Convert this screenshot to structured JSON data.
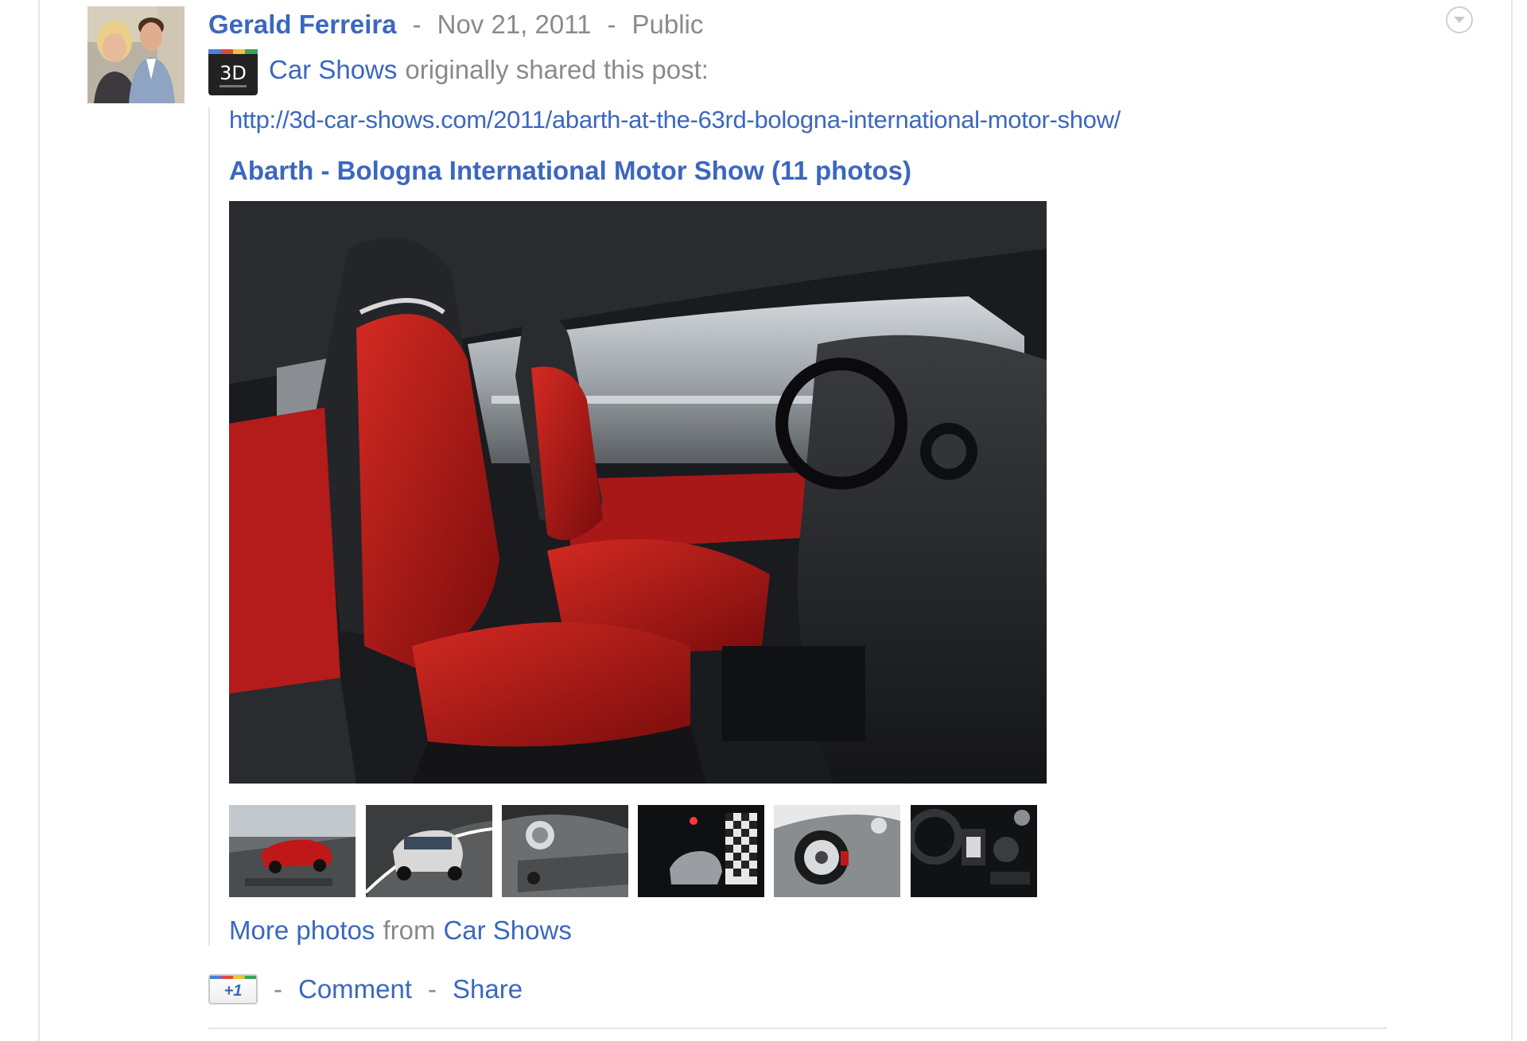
{
  "post": {
    "author": "Gerald Ferreira",
    "separator": "-",
    "date": "Nov 21, 2011",
    "visibility": "Public",
    "menu_icon": "chevron-down-circle-icon"
  },
  "reshare": {
    "source_name": "Car Shows",
    "source_icon_text": "3D",
    "suffix": "originally shared this post:"
  },
  "attachment": {
    "url": "http://3d-car-shows.com/2011/abarth-at-the-63rd-bologna-international-motor-show/",
    "album_title": "Abarth - Bologna International Motor Show (11 photos)",
    "more_photos_label": "More photos",
    "from_label": "from",
    "more_photos_source": "Car Shows"
  },
  "actions": {
    "plus_one_label": "+1",
    "separator": "-",
    "comment": "Comment",
    "share": "Share"
  },
  "colors": {
    "link": "#3b67c0",
    "muted": "#8a8a8a",
    "seat_red": "#b01818"
  }
}
